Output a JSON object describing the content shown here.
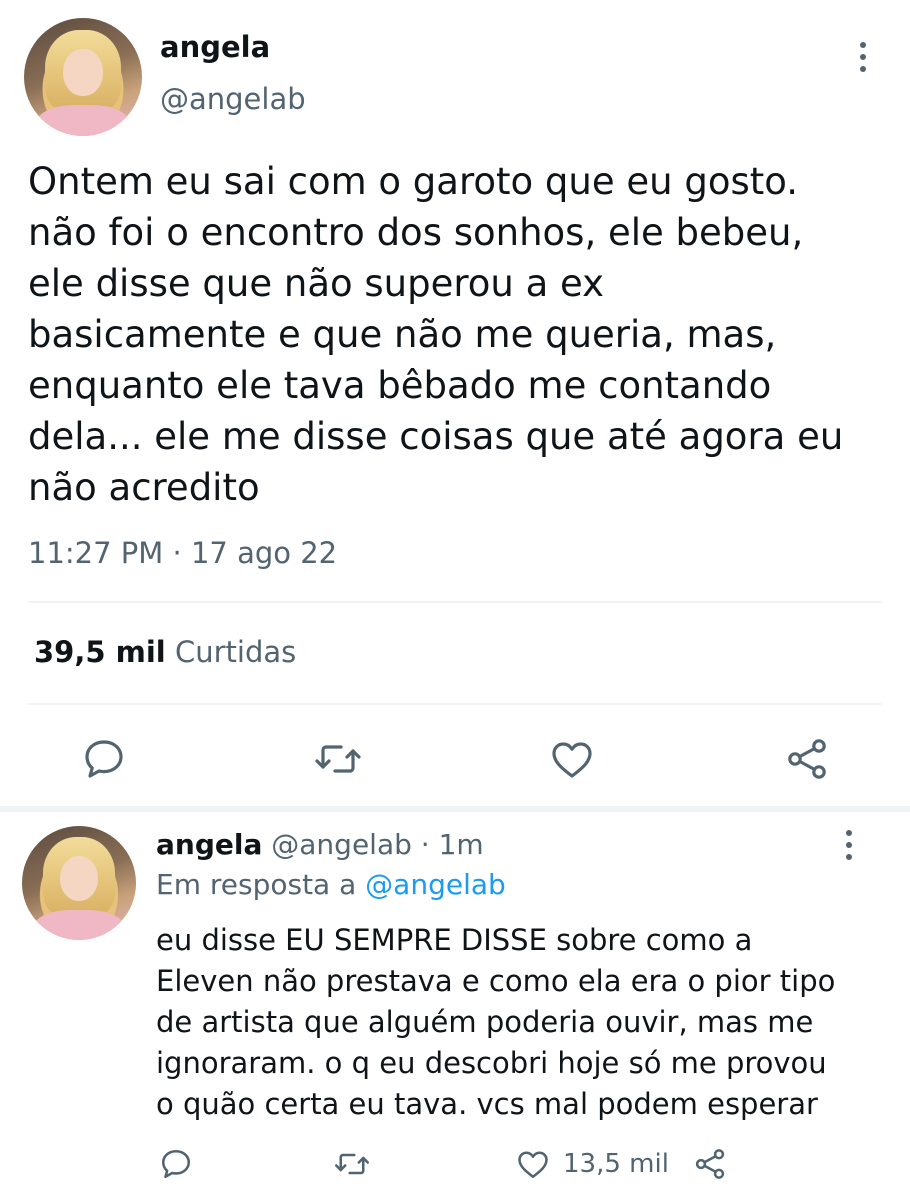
{
  "main_tweet": {
    "author_name": "angela",
    "author_handle": "@angelab",
    "text": "Ontem eu sai com o garoto que eu gosto.\nnão foi o encontro dos sonhos, ele bebeu,\nele disse que não superou a ex\nbasicamente e que não me queria, mas,\nenquanto ele tava bêbado me contando\ndela... ele me disse coisas que até agora eu\nnão acredito",
    "timestamp": "11:27 PM · 17 ago 22",
    "likes_count": "39,5 mil",
    "likes_label": "Curtidas"
  },
  "reply": {
    "author_name": "angela",
    "author_handle": "@angelab",
    "separator": "·",
    "time_ago": "1m",
    "reply_prefix": "Em resposta a",
    "reply_to": "@angelab",
    "text": "eu disse EU SEMPRE DISSE sobre como a\nEleven não prestava e como ela era o pior tipo\nde artista que alguém poderia ouvir, mas me\nignoraram. o q eu descobri hoje só me provou\no quão certa eu tava. vcs mal podem esperar",
    "like_count": "13,5 mil"
  },
  "icons": {
    "reply": "speech-bubble-icon",
    "retweet": "retweet-icon",
    "like": "heart-icon",
    "share": "share-icon",
    "more": "more-vertical-icon"
  },
  "colors": {
    "text": "#0f1419",
    "secondary": "#536471",
    "link": "#1d9bf0",
    "divider": "#eff3f4"
  }
}
